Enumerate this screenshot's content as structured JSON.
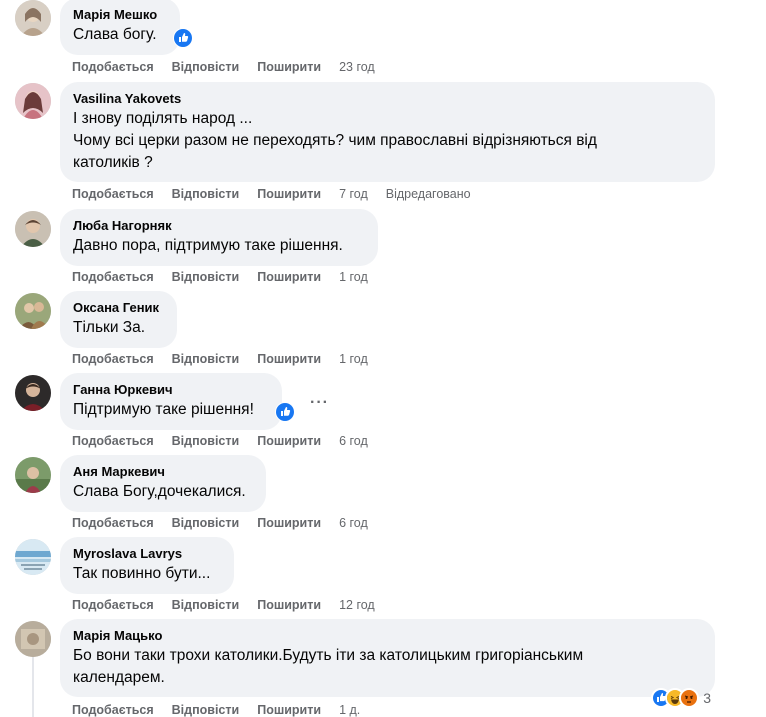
{
  "actions": {
    "like": "Подобається",
    "reply": "Відповісти",
    "share": "Поширити",
    "edited": "Відредаговано"
  },
  "comments": [
    {
      "author": "Марія Мешко",
      "lines": [
        "Слава богу."
      ],
      "time": "23 год"
    },
    {
      "author": "Vasilina Yakovets",
      "lines": [
        "І знову поділять народ ...",
        "Чому всі церки разом не переходять? чим православні відрізняються від",
        "католиків ?"
      ],
      "time": "7 год"
    },
    {
      "author": "Люба Нагорняк",
      "lines": [
        "Давно пора, підтримую таке рішення."
      ],
      "time": "1 год"
    },
    {
      "author": "Оксана Геник",
      "lines": [
        "Тільки За."
      ],
      "time": "1 год"
    },
    {
      "author": "Ганна Юркевич",
      "lines": [
        "Підтримую таке рішення!"
      ],
      "time": "6 год"
    },
    {
      "author": "Аня Маркевич",
      "lines": [
        "Слава Богу,дочекалися."
      ],
      "time": "6 год"
    },
    {
      "author": "Myroslava Lavrys",
      "lines": [
        "Так повинно бути..."
      ],
      "time": "12 год"
    },
    {
      "author": "Марія Мацько",
      "lines": [
        "Бо вони таки трохи католики.Будуть іти за католицьким григоріанським",
        "календарем."
      ],
      "time": "1 д."
    }
  ],
  "reactions": {
    "count": "3"
  },
  "colors": {
    "bubble": "#f0f2f5",
    "meta": "#65676b",
    "like_blue": "#1877f2",
    "haha_yellow": "#f7b928",
    "angry_orange": "#e9710f"
  },
  "icons": {
    "like": "thumbs-up-icon",
    "haha": "haha-face-icon",
    "angry": "angry-face-icon",
    "more": "more-options-icon"
  }
}
